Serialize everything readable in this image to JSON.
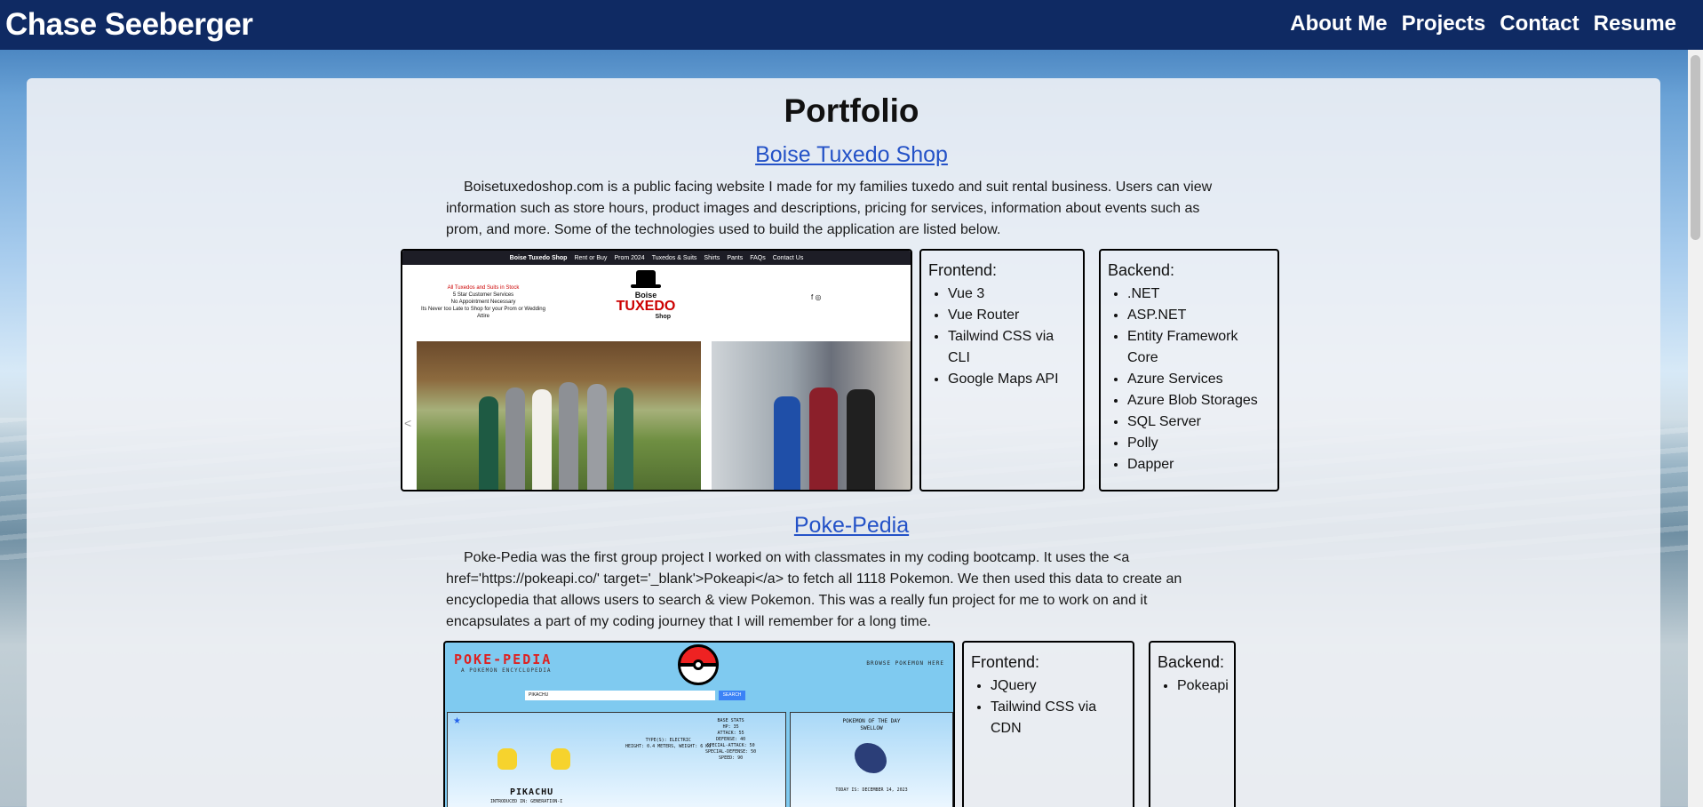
{
  "header": {
    "brand": "Chase Seeberger",
    "nav": [
      "About Me",
      "Projects",
      "Contact",
      "Resume"
    ]
  },
  "page": {
    "title": "Portfolio"
  },
  "projects": [
    {
      "title": "Boise Tuxedo Shop",
      "description": "Boisetuxedoshop.com is a public facing website I made for my families tuxedo and suit rental business. Users can view information such as store hours, product images and descriptions, pricing for services, information about events such as prom, and more. Some of the technologies used to build the application are listed below.",
      "screenshot": {
        "nav_brand": "Boise Tuxedo Shop",
        "nav_items": [
          "Rent or Buy",
          "Prom 2024",
          "Tuxedos & Suits",
          "Shirts",
          "Pants",
          "FAQs",
          "Contact Us"
        ],
        "tagline_lines": [
          "All Tuxedos and Suits in Stock",
          "5 Star Customer Services",
          "No Appointment Necessary",
          "Its Never too Late to Shop for your Prom or Wedding Attire"
        ],
        "logo_top": "Boise",
        "logo_main": "TUXEDO",
        "logo_bottom": "Shop",
        "social": "f ◎",
        "carousel_prev": "<"
      },
      "frontend": {
        "heading": "Frontend:",
        "items": [
          "Vue 3",
          "Vue Router",
          "Tailwind CSS via CLI",
          "Google Maps API"
        ]
      },
      "backend": {
        "heading": "Backend:",
        "items": [
          ".NET",
          "ASP.NET",
          "Entity Framework Core",
          "Azure Services",
          "Azure Blob Storages",
          "SQL Server",
          "Polly",
          "Dapper"
        ]
      }
    },
    {
      "title": "Poke-Pedia",
      "description": "Poke-Pedia was the first group project I worked on with classmates in my coding bootcamp. It uses the <a href='https://pokeapi.co/' target='_blank'>Pokeapi</a> to fetch all 1118 Pokemon. We then used this data to create an encyclopedia that allows users to search & view Pokemon. This was a really fun project for me to work on and it encapsulates a part of my coding journey that I will remember for a long time.",
      "screenshot": {
        "title": "POKE-PEDIA",
        "subtitle": "A POKEMON ENCYCLOPEDIA",
        "browse": "BROWSE POKEMON HERE",
        "search_value": "PIKACHU",
        "search_button": "SEARCH",
        "pokemon_name": "PIKACHU",
        "intro": "INTRODUCED IN: GENERATION-I",
        "type_lines": [
          "TYPE(S): ELECTRIC",
          "HEIGHT: 0.4 METERS, WEIGHT: 6 KG"
        ],
        "stats_lines": [
          "BASE STATS",
          "HP: 35",
          "ATTACK: 55",
          "DEFENSE: 40",
          "SPECIAL-ATTACK: 50",
          "SPECIAL-DEFENSE: 50",
          "SPEED: 90"
        ],
        "pod_title": "POKEMON OF THE DAY",
        "pod_name": "SWELLOW",
        "today": "TODAY IS: DECEMBER 14, 2023"
      },
      "frontend": {
        "heading": "Frontend:",
        "items": [
          "JQuery",
          "Tailwind CSS via CDN"
        ]
      },
      "backend": {
        "heading": "Backend:",
        "items": [
          "Pokeapi"
        ]
      }
    }
  ]
}
